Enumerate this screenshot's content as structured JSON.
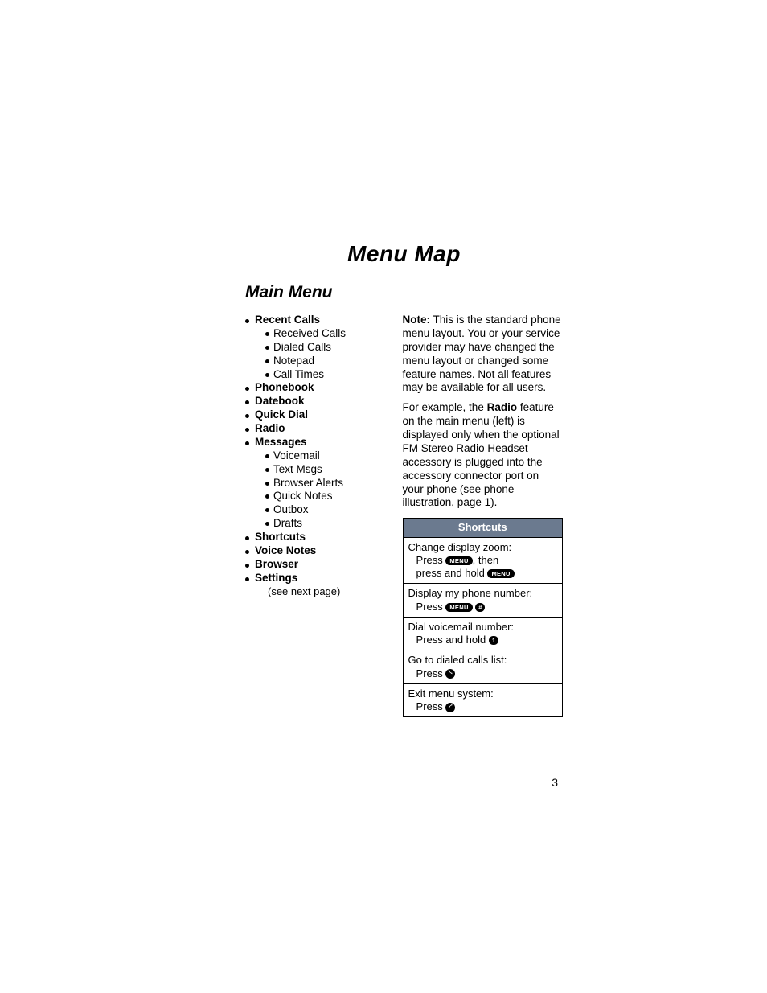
{
  "title": "Menu Map",
  "section": "Main Menu",
  "menu": {
    "recent_calls": "Recent Calls",
    "received_calls": "Received Calls",
    "dialed_calls": "Dialed Calls",
    "notepad": "Notepad",
    "call_times": "Call Times",
    "phonebook": "Phonebook",
    "datebook": "Datebook",
    "quick_dial": "Quick Dial",
    "radio": "Radio",
    "messages": "Messages",
    "voicemail": "Voicemail",
    "text_msgs": "Text Msgs",
    "browser_alerts": "Browser Alerts",
    "quick_notes": "Quick Notes",
    "outbox": "Outbox",
    "drafts": "Drafts",
    "shortcuts": "Shortcuts",
    "voice_notes": "Voice Notes",
    "browser": "Browser",
    "settings": "Settings",
    "settings_note": "(see next page)"
  },
  "note": {
    "label": "Note:",
    "para1_rest": " This is the standard phone menu layout. You or your service provider may have changed the menu layout or changed some feature names. Not all features may be available for all users.",
    "para2_a": "For example, the ",
    "para2_bold": "Radio",
    "para2_b": " feature on the main menu (left) is displayed only when the optional FM Stereo Radio Headset accessory is plugged into the accessory connector port on your phone (see phone illustration, page 1)."
  },
  "shortcuts": {
    "header": "Shortcuts",
    "rows": [
      {
        "title": "Change display zoom:",
        "line1_a": "Press ",
        "line1_btn": "MENU",
        "line1_b": ", then",
        "line2_a": "press and hold ",
        "line2_btn": "MENU"
      },
      {
        "title": "Display my phone number:",
        "line1_a": "Press ",
        "line1_btn1": "MENU",
        "line1_btn2": "#"
      },
      {
        "title": "Dial voicemail number:",
        "line1_a": "Press and hold ",
        "line1_btn": "1"
      },
      {
        "title": "Go to dialed calls list:",
        "line1_a": "Press ",
        "line1_icon": "send"
      },
      {
        "title": "Exit menu system:",
        "line1_a": "Press ",
        "line1_icon": "end"
      }
    ]
  },
  "page_number": "3"
}
